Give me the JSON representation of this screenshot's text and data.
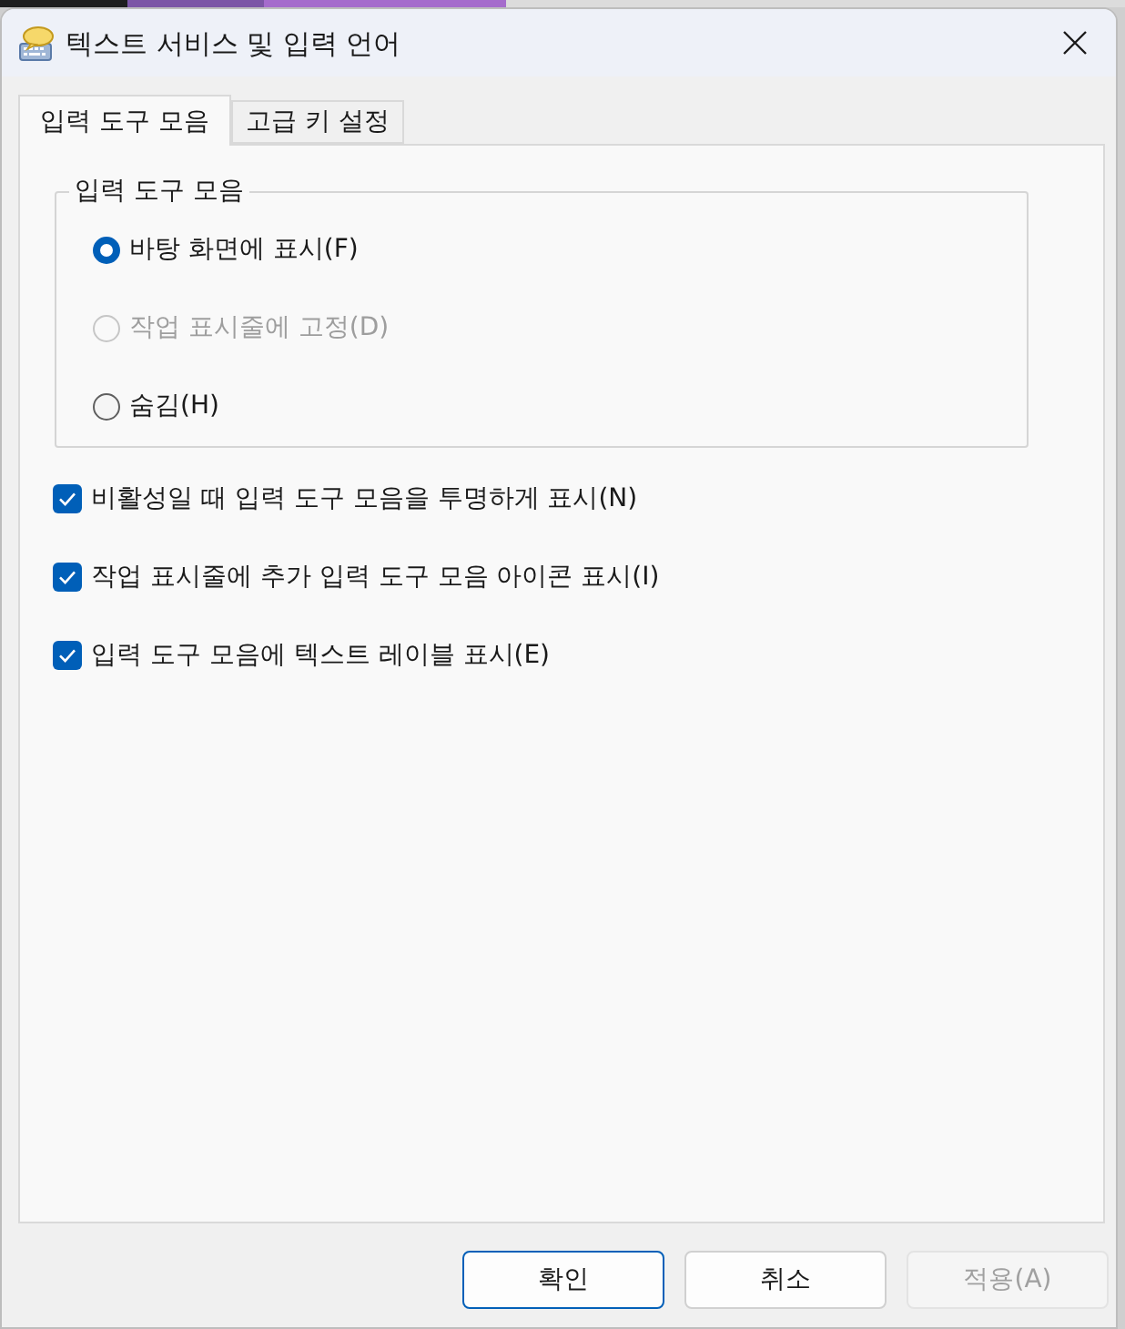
{
  "window": {
    "title": "텍스트 서비스 및 입력 언어"
  },
  "tabs": [
    {
      "label": "입력 도구 모음",
      "selected": true
    },
    {
      "label": "고급 키 설정",
      "selected": false
    }
  ],
  "language_bar_group": {
    "title": "입력 도구 모음",
    "options": [
      {
        "label": "바탕 화면에 표시(F)",
        "selected": true,
        "disabled": false
      },
      {
        "label": "작업 표시줄에 고정(D)",
        "selected": false,
        "disabled": true
      },
      {
        "label": "숨김(H)",
        "selected": false,
        "disabled": false
      }
    ]
  },
  "checkboxes": [
    {
      "label": "비활성일 때 입력 도구 모음을 투명하게 표시(N)",
      "checked": true
    },
    {
      "label": "작업 표시줄에 추가 입력 도구 모음 아이콘 표시(I)",
      "checked": true
    },
    {
      "label": "입력 도구 모음에 텍스트 레이블 표시(E)",
      "checked": true
    }
  ],
  "buttons": [
    {
      "label": "확인",
      "default": true,
      "disabled": false
    },
    {
      "label": "취소",
      "default": false,
      "disabled": false
    },
    {
      "label": "적용(A)",
      "default": false,
      "disabled": true
    }
  ]
}
